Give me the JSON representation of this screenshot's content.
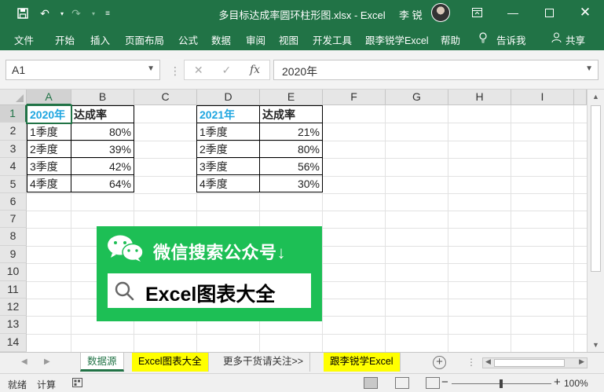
{
  "titlebar": {
    "title": "多目标达成率圆环柱形图.xlsx  -  Excel",
    "user": "李 锐",
    "quick_access": [
      "save-icon",
      "undo-icon",
      "redo-icon",
      "customize-icon"
    ],
    "window_buttons": [
      "ribbon-display-icon",
      "minimize-icon",
      "maximize-icon",
      "close-icon"
    ]
  },
  "ribbon": {
    "tabs": [
      "文件",
      "开始",
      "插入",
      "页面布局",
      "公式",
      "数据",
      "审阅",
      "视图",
      "开发工具",
      "跟李锐学Excel",
      "帮助"
    ],
    "tell_me": "告诉我",
    "share": "共享"
  },
  "formula_bar": {
    "name_box": "A1",
    "fx": "fx",
    "content": "2020年"
  },
  "grid": {
    "columns": [
      "A",
      "B",
      "C",
      "D",
      "E",
      "F",
      "G",
      "H",
      "I"
    ],
    "rows": [
      "1",
      "2",
      "3",
      "4",
      "5",
      "6",
      "7",
      "8",
      "9",
      "10",
      "11",
      "12",
      "13",
      "14"
    ],
    "table1": {
      "headers": [
        "2020年",
        "达成率"
      ],
      "rows": [
        [
          "1季度",
          "80%"
        ],
        [
          "2季度",
          "39%"
        ],
        [
          "3季度",
          "42%"
        ],
        [
          "4季度",
          "64%"
        ]
      ]
    },
    "table2": {
      "headers": [
        "2021年",
        "达成率"
      ],
      "rows": [
        [
          "1季度",
          "21%"
        ],
        [
          "2季度",
          "80%"
        ],
        [
          "3季度",
          "56%"
        ],
        [
          "4季度",
          "30%"
        ]
      ]
    },
    "selected_cell": "A1"
  },
  "banner": {
    "line1": "微信搜索公众号↓",
    "line2": "Excel图表大全",
    "bg_color": "#1dbf55"
  },
  "sheet_tabs": {
    "tabs": [
      "数据源",
      "Excel图表大全",
      "更多干货请关注>>",
      "跟李锐学Excel"
    ],
    "active": "数据源",
    "highlight_color": "#ffff00"
  },
  "status_bar": {
    "ready": "就绪",
    "calculate": "计算",
    "zoom": "100%"
  },
  "colors": {
    "accent": "#217346",
    "year_header": "#1fa6e0"
  }
}
